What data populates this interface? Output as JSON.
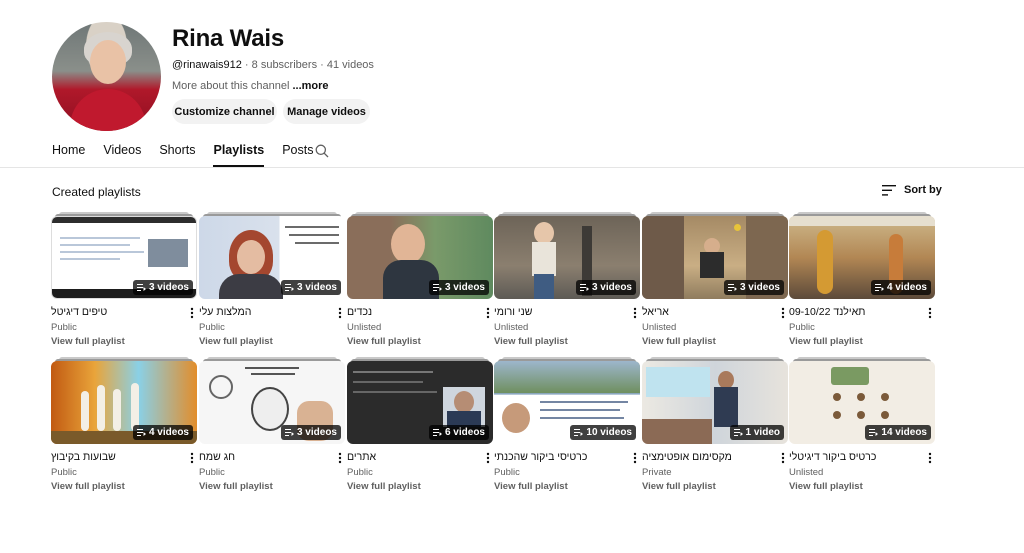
{
  "channel": {
    "name": "Rina Wais",
    "handle": "@rinawais912",
    "stats": " · 8 subscribers · 41 videos",
    "about": "More about this channel ",
    "about_more": "...more",
    "customize_label": "Customize channel",
    "manage_label": "Manage videos"
  },
  "tabs": [
    {
      "label": "Home"
    },
    {
      "label": "Videos"
    },
    {
      "label": "Shorts"
    },
    {
      "label": "Playlists"
    },
    {
      "label": "Posts"
    }
  ],
  "section": {
    "title": "Created playlists",
    "sort_label": "Sort by"
  },
  "playlists": [
    {
      "title": "טיפים דיגיטל",
      "visibility": "Public",
      "count": "3 videos",
      "view": "View full playlist"
    },
    {
      "title": "המלצות עלי",
      "visibility": "Public",
      "count": "3 videos",
      "view": "View full playlist"
    },
    {
      "title": "נכדים",
      "visibility": "Unlisted",
      "count": "3 videos",
      "view": "View full playlist"
    },
    {
      "title": "שני ורומי",
      "visibility": "Unlisted",
      "count": "3 videos",
      "view": "View full playlist"
    },
    {
      "title": "אריאל",
      "visibility": "Unlisted",
      "count": "3 videos",
      "view": "View full playlist"
    },
    {
      "title": "תאילנד 09-10/22",
      "visibility": "Public",
      "count": "4 videos",
      "view": "View full playlist"
    },
    {
      "title": "שבועות בקיבוץ",
      "visibility": "Public",
      "count": "4 videos",
      "view": "View full playlist"
    },
    {
      "title": "חג שמח",
      "visibility": "Public",
      "count": "3 videos",
      "view": "View full playlist"
    },
    {
      "title": "אתרים",
      "visibility": "Public",
      "count": "6 videos",
      "view": "View full playlist"
    },
    {
      "title": "כרטיסי ביקור שהכנתי",
      "visibility": "Public",
      "count": "10 videos",
      "view": "View full playlist"
    },
    {
      "title": "מקסימום אופטימציה",
      "visibility": "Private",
      "count": "1 video",
      "view": "View full playlist"
    },
    {
      "title": "כרטיס ביקור דיגיטלי",
      "visibility": "Unlisted",
      "count": "14 videos",
      "view": "View full playlist"
    }
  ],
  "icons": {
    "search": "search-icon",
    "sort": "sort-icon",
    "kebab": "more-vert-icon",
    "playlist": "playlist-icon"
  }
}
